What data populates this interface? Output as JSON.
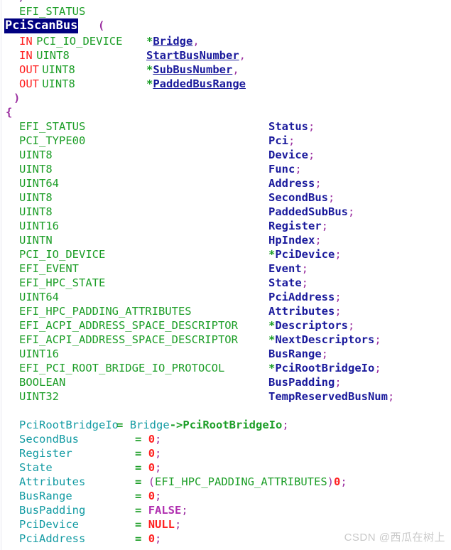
{
  "editor": {
    "language": "C",
    "background_color": "#ffffff",
    "selection_background": "#000080",
    "selection_foreground": "#ffffff",
    "colors": {
      "type": "#1d9e28",
      "keyword": "#ff2020",
      "variable": "#1a1a9c",
      "punctuation": "#9b2fa0",
      "identifier": "#139ba3",
      "operator": "#1d9e28",
      "number": "#ff2020",
      "boolean": "#b02fb0",
      "null": "#ff2020",
      "gutter_rule": "#e8e8ef"
    }
  },
  "top_clip": "/",
  "signature": {
    "return_type": "EFI_STATUS",
    "function_name": "PciScanBus",
    "open_paren": "(",
    "close_paren": ")",
    "open_brace": "{",
    "parameters": [
      {
        "direction": "IN",
        "type": "PCI_IO_DEVICE",
        "star": "*",
        "name": "Bridge",
        "comma": ","
      },
      {
        "direction": "IN",
        "type": "UINT8",
        "star": "",
        "name": "StartBusNumber",
        "comma": ","
      },
      {
        "direction": "OUT",
        "type": "UINT8",
        "star": "*",
        "name": "SubBusNumber",
        "comma": ","
      },
      {
        "direction": "OUT",
        "type": "UINT8",
        "star": "*",
        "name": "PaddedBusRange",
        "comma": ""
      }
    ]
  },
  "declarations": [
    {
      "type": "EFI_STATUS",
      "star": "",
      "name": "Status",
      "semicolon": ";"
    },
    {
      "type": "PCI_TYPE00",
      "star": "",
      "name": "Pci",
      "semicolon": ";"
    },
    {
      "type": "UINT8",
      "star": "",
      "name": "Device",
      "semicolon": ";"
    },
    {
      "type": "UINT8",
      "star": "",
      "name": "Func",
      "semicolon": ";"
    },
    {
      "type": "UINT64",
      "star": "",
      "name": "Address",
      "semicolon": ";"
    },
    {
      "type": "UINT8",
      "star": "",
      "name": "SecondBus",
      "semicolon": ";"
    },
    {
      "type": "UINT8",
      "star": "",
      "name": "PaddedSubBus",
      "semicolon": ";"
    },
    {
      "type": "UINT16",
      "star": "",
      "name": "Register",
      "semicolon": ";"
    },
    {
      "type": "UINTN",
      "star": "",
      "name": "HpIndex",
      "semicolon": ";"
    },
    {
      "type": "PCI_IO_DEVICE",
      "star": "*",
      "name": "PciDevice",
      "semicolon": ";"
    },
    {
      "type": "EFI_EVENT",
      "star": "",
      "name": "Event",
      "semicolon": ";"
    },
    {
      "type": "EFI_HPC_STATE",
      "star": "",
      "name": "State",
      "semicolon": ";"
    },
    {
      "type": "UINT64",
      "star": "",
      "name": "PciAddress",
      "semicolon": ";"
    },
    {
      "type": "EFI_HPC_PADDING_ATTRIBUTES",
      "star": "",
      "name": "Attributes",
      "semicolon": ";"
    },
    {
      "type": "EFI_ACPI_ADDRESS_SPACE_DESCRIPTOR",
      "star": "*",
      "name": "Descriptors",
      "semicolon": ";"
    },
    {
      "type": "EFI_ACPI_ADDRESS_SPACE_DESCRIPTOR",
      "star": "*",
      "name": "NextDescriptors",
      "semicolon": ";"
    },
    {
      "type": "UINT16",
      "star": "",
      "name": "BusRange",
      "semicolon": ";"
    },
    {
      "type": "EFI_PCI_ROOT_BRIDGE_IO_PROTOCOL",
      "star": "*",
      "name": "PciRootBridgeIo",
      "semicolon": ";"
    },
    {
      "type": "BOOLEAN",
      "star": "",
      "name": "BusPadding",
      "semicolon": ";"
    },
    {
      "type": "UINT32",
      "star": "",
      "name": "TempReservedBusNum",
      "semicolon": ";"
    }
  ],
  "assignments": [
    {
      "target": "PciRootBridgeIo",
      "eq": "=",
      "value": {
        "object": "Bridge",
        "arrow": "->",
        "member": "PciRootBridgeIo"
      },
      "kind": "member",
      "semicolon": ";"
    },
    {
      "target": "SecondBus",
      "eq": "=",
      "value": "0",
      "kind": "number",
      "semicolon": ";"
    },
    {
      "target": "Register",
      "eq": "=",
      "value": "0",
      "kind": "number",
      "semicolon": ";"
    },
    {
      "target": "State",
      "eq": "=",
      "value": "0",
      "kind": "number",
      "semicolon": ";"
    },
    {
      "target": "Attributes",
      "eq": "=",
      "value": {
        "cast": "EFI_HPC_PADDING_ATTRIBUTES",
        "literal": "0"
      },
      "kind": "cast",
      "semicolon": ";"
    },
    {
      "target": "BusRange",
      "eq": "=",
      "value": "0",
      "kind": "number",
      "semicolon": ";"
    },
    {
      "target": "BusPadding",
      "eq": "=",
      "value": "FALSE",
      "kind": "boolean",
      "semicolon": ";"
    },
    {
      "target": "PciDevice",
      "eq": "=",
      "value": "NULL",
      "kind": "null",
      "semicolon": ";"
    },
    {
      "target": "PciAddress",
      "eq": "=",
      "value": "0",
      "kind": "number",
      "semicolon": ";"
    }
  ],
  "watermark": "CSDN @西瓜在树上"
}
